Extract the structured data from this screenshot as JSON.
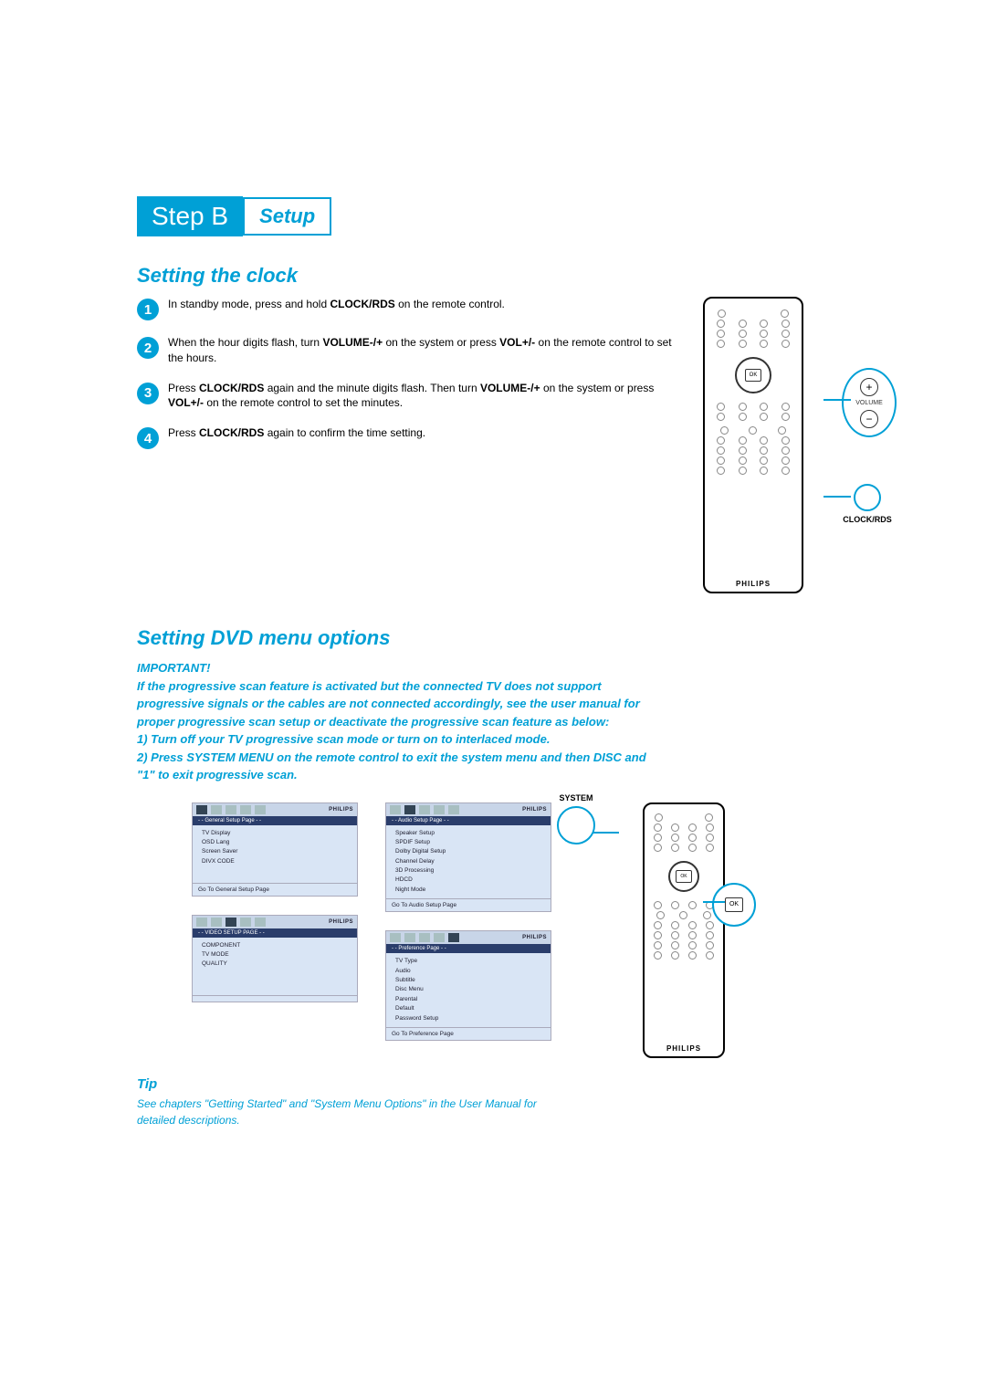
{
  "header": {
    "step_badge": "Step B",
    "setup_badge": "Setup"
  },
  "section1": {
    "title": "Setting the clock",
    "steps": [
      {
        "num": "1",
        "pre": "In standby mode, press and hold ",
        "kw1": "CLOCK/RDS",
        "post": " on the remote control."
      },
      {
        "num": "2",
        "pre": "When the hour digits flash, turn ",
        "kw1": "VOLUME-/+",
        "mid1": " on the system or press ",
        "kw2": "VOL+/-",
        "post": " on the remote control to set the hours."
      },
      {
        "num": "3",
        "pre": "Press ",
        "kw1": "CLOCK/RDS",
        "mid1": " again and the minute digits flash. Then turn ",
        "kw2": "VOLUME-/+",
        "mid2": " on the system or press ",
        "kw3": "VOL+/-",
        "post": " on the remote control to set the minutes."
      },
      {
        "num": "4",
        "pre": "Press ",
        "kw1": "CLOCK/RDS",
        "post": " again to confirm the time setting."
      }
    ],
    "callout_volume": "VOLUME",
    "callout_clock": "CLOCK/RDS",
    "ok": "OK",
    "brand": "PHILIPS"
  },
  "section2": {
    "title": "Setting DVD menu options",
    "important_label": "IMPORTANT!",
    "important_body1": "If the progressive scan feature is activated but the connected TV does not support progressive signals or the cables are not connected accordingly, see the user manual for proper progressive scan setup or deactivate the progressive scan feature as below:",
    "important_body2": "1) Turn off your TV progressive scan mode or turn on to interlaced mode.",
    "important_body3": "2) Press SYSTEM MENU on the remote control to exit the system menu and then DISC and \"1\" to exit progressive scan.",
    "osd_brand": "PHILIPS",
    "osd": [
      {
        "tab": "- - General Setup Page - -",
        "items": [
          "TV Display",
          "OSD Lang",
          "Screen Saver",
          "DIVX CODE"
        ],
        "footer": "Go To General Setup Page"
      },
      {
        "tab": "- - Audio Setup Page - -",
        "items": [
          "Speaker Setup",
          "SPDIF Setup",
          "Dolby Digital Setup",
          "Channel Delay",
          "3D Processing",
          "HDCD",
          "Night Mode"
        ],
        "footer": "Go To Audio Setup Page"
      },
      {
        "tab": "- - VIDEO SETUP PAGE - -",
        "items": [
          "COMPONENT",
          "TV MODE",
          "QUALITY"
        ],
        "footer": ""
      },
      {
        "tab": "- - Preference Page - -",
        "items": [
          "TV Type",
          "Audio",
          "Subtitle",
          "Disc Menu",
          "Parental",
          "Default",
          "Password Setup"
        ],
        "footer": "Go To Preference Page"
      }
    ],
    "callout_system": "SYSTEM",
    "callout_ok": "OK",
    "brand": "PHILIPS"
  },
  "tip": {
    "title": "Tip",
    "text": "See chapters \"Getting Started\" and \"System Menu Options\" in the User Manual for detailed descriptions."
  }
}
